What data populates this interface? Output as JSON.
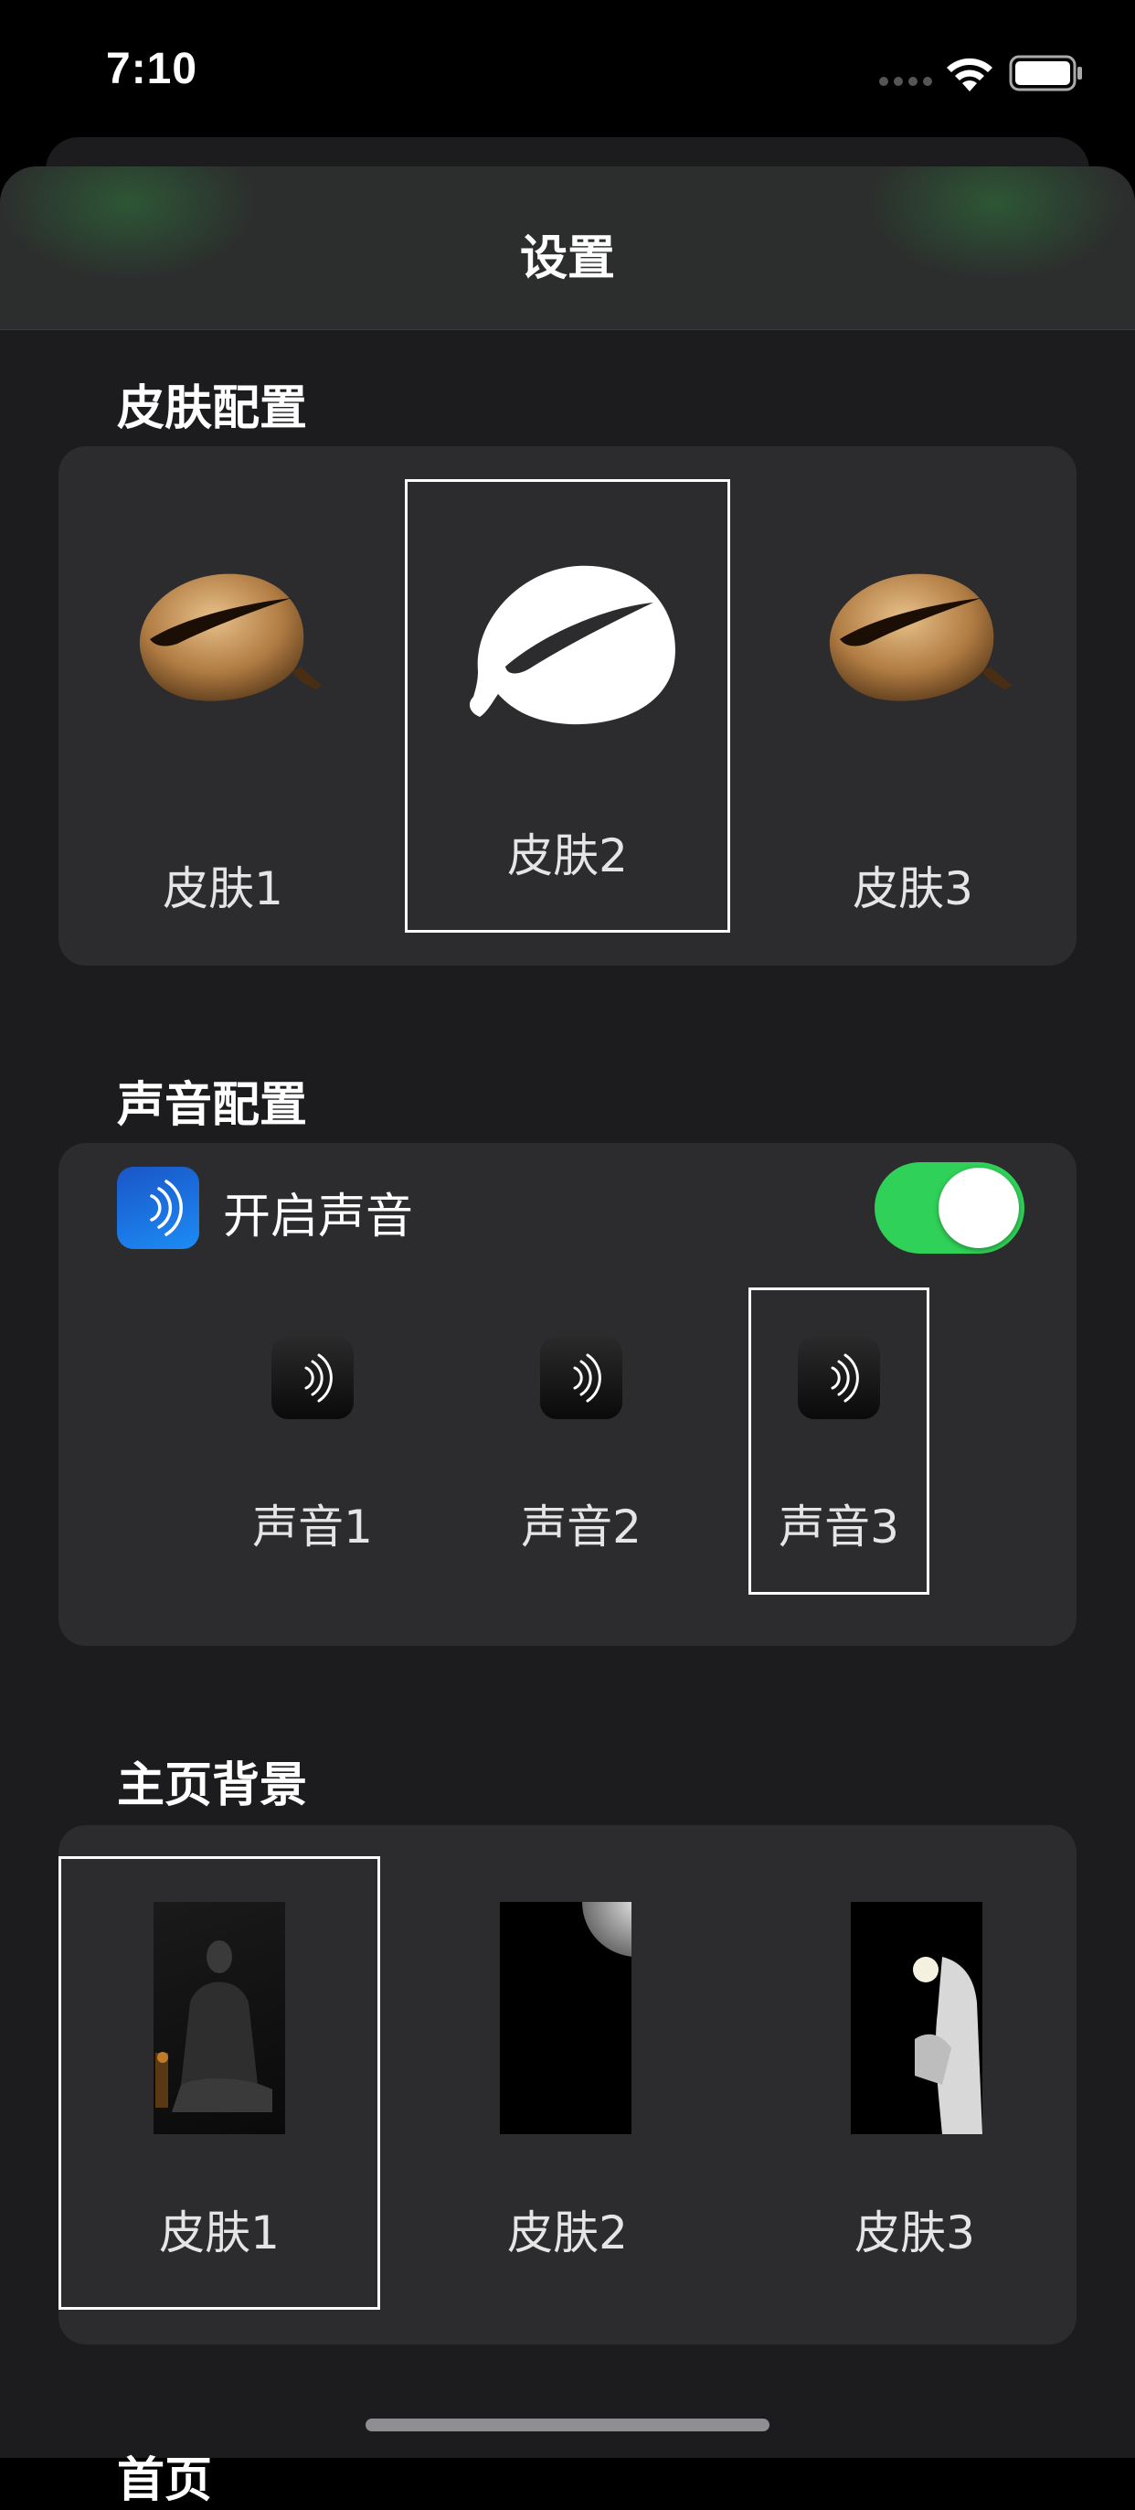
{
  "status": {
    "time": "7:10"
  },
  "title": "设置",
  "skin_section": {
    "title": "皮肤配置",
    "options": [
      {
        "label": "皮肤1",
        "selected": false
      },
      {
        "label": "皮肤2",
        "selected": true
      },
      {
        "label": "皮肤3",
        "selected": false
      }
    ]
  },
  "sound_section": {
    "title": "声音配置",
    "toggle_label": "开启声音",
    "toggle_on": true,
    "options": [
      {
        "label": "声音1",
        "selected": false
      },
      {
        "label": "声音2",
        "selected": false
      },
      {
        "label": "声音3",
        "selected": true
      }
    ]
  },
  "background_section": {
    "title": "主页背景",
    "options": [
      {
        "label": "皮肤1",
        "selected": true
      },
      {
        "label": "皮肤2",
        "selected": false
      },
      {
        "label": "皮肤3",
        "selected": false
      }
    ]
  },
  "next_section_title": "首页",
  "colors": {
    "toggle_on": "#30d158",
    "card": "#2c2c2e",
    "sheet": "#1c1c1e",
    "sound_app": "#1c8cf5"
  }
}
